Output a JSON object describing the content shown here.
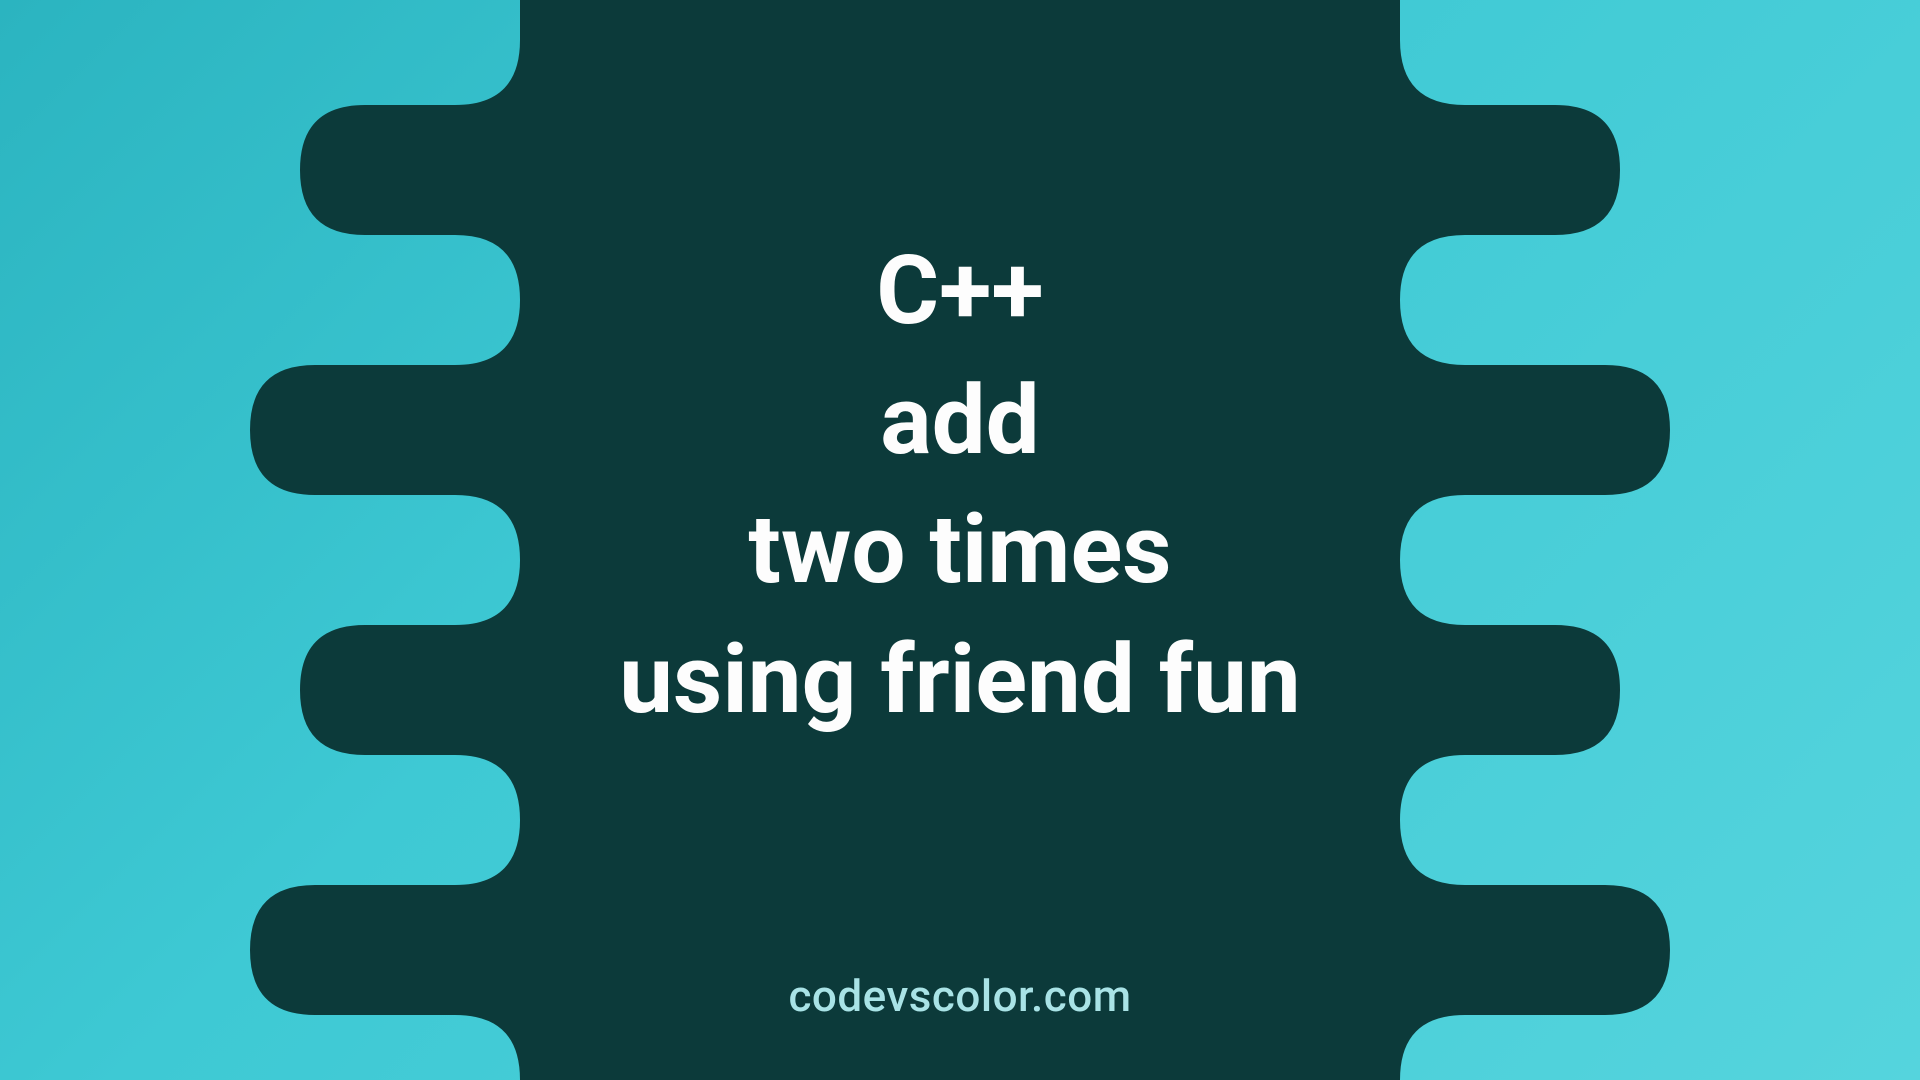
{
  "title": {
    "lines": [
      "C++",
      "add",
      "two times",
      "using friend fun"
    ]
  },
  "credit": "codevscolor.com",
  "colors": {
    "background_start": "#2bb4c0",
    "background_end": "#55d4dd",
    "blob": "#0c3a3a",
    "text": "#fdfdfd",
    "credit": "#a9e3e6"
  }
}
